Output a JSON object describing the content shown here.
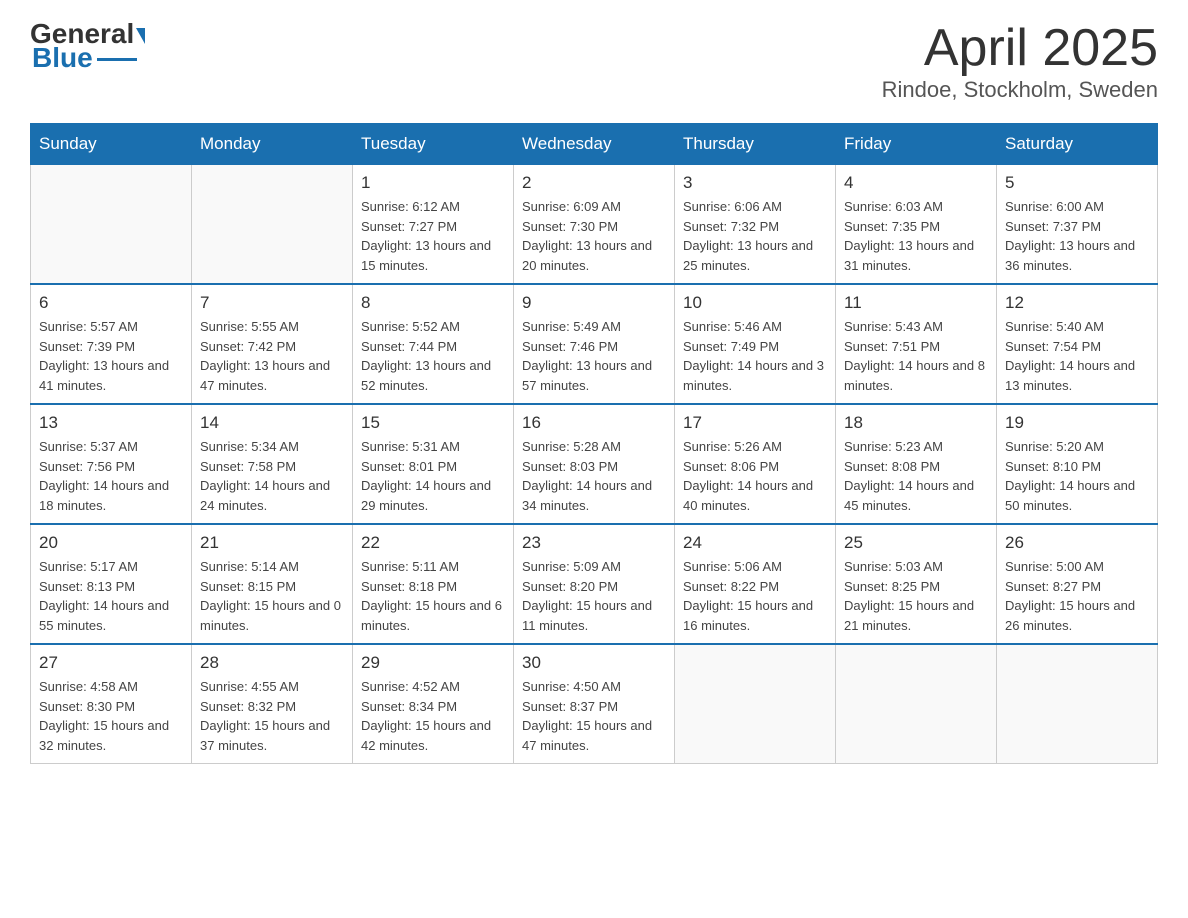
{
  "header": {
    "logo_general": "General",
    "logo_blue": "Blue",
    "month_title": "April 2025",
    "subtitle": "Rindoe, Stockholm, Sweden"
  },
  "days_of_week": [
    "Sunday",
    "Monday",
    "Tuesday",
    "Wednesday",
    "Thursday",
    "Friday",
    "Saturday"
  ],
  "weeks": [
    [
      {
        "day": "",
        "sunrise": "",
        "sunset": "",
        "daylight": "",
        "empty": true
      },
      {
        "day": "",
        "sunrise": "",
        "sunset": "",
        "daylight": "",
        "empty": true
      },
      {
        "day": "1",
        "sunrise": "Sunrise: 6:12 AM",
        "sunset": "Sunset: 7:27 PM",
        "daylight": "Daylight: 13 hours and 15 minutes."
      },
      {
        "day": "2",
        "sunrise": "Sunrise: 6:09 AM",
        "sunset": "Sunset: 7:30 PM",
        "daylight": "Daylight: 13 hours and 20 minutes."
      },
      {
        "day": "3",
        "sunrise": "Sunrise: 6:06 AM",
        "sunset": "Sunset: 7:32 PM",
        "daylight": "Daylight: 13 hours and 25 minutes."
      },
      {
        "day": "4",
        "sunrise": "Sunrise: 6:03 AM",
        "sunset": "Sunset: 7:35 PM",
        "daylight": "Daylight: 13 hours and 31 minutes."
      },
      {
        "day": "5",
        "sunrise": "Sunrise: 6:00 AM",
        "sunset": "Sunset: 7:37 PM",
        "daylight": "Daylight: 13 hours and 36 minutes."
      }
    ],
    [
      {
        "day": "6",
        "sunrise": "Sunrise: 5:57 AM",
        "sunset": "Sunset: 7:39 PM",
        "daylight": "Daylight: 13 hours and 41 minutes."
      },
      {
        "day": "7",
        "sunrise": "Sunrise: 5:55 AM",
        "sunset": "Sunset: 7:42 PM",
        "daylight": "Daylight: 13 hours and 47 minutes."
      },
      {
        "day": "8",
        "sunrise": "Sunrise: 5:52 AM",
        "sunset": "Sunset: 7:44 PM",
        "daylight": "Daylight: 13 hours and 52 minutes."
      },
      {
        "day": "9",
        "sunrise": "Sunrise: 5:49 AM",
        "sunset": "Sunset: 7:46 PM",
        "daylight": "Daylight: 13 hours and 57 minutes."
      },
      {
        "day": "10",
        "sunrise": "Sunrise: 5:46 AM",
        "sunset": "Sunset: 7:49 PM",
        "daylight": "Daylight: 14 hours and 3 minutes."
      },
      {
        "day": "11",
        "sunrise": "Sunrise: 5:43 AM",
        "sunset": "Sunset: 7:51 PM",
        "daylight": "Daylight: 14 hours and 8 minutes."
      },
      {
        "day": "12",
        "sunrise": "Sunrise: 5:40 AM",
        "sunset": "Sunset: 7:54 PM",
        "daylight": "Daylight: 14 hours and 13 minutes."
      }
    ],
    [
      {
        "day": "13",
        "sunrise": "Sunrise: 5:37 AM",
        "sunset": "Sunset: 7:56 PM",
        "daylight": "Daylight: 14 hours and 18 minutes."
      },
      {
        "day": "14",
        "sunrise": "Sunrise: 5:34 AM",
        "sunset": "Sunset: 7:58 PM",
        "daylight": "Daylight: 14 hours and 24 minutes."
      },
      {
        "day": "15",
        "sunrise": "Sunrise: 5:31 AM",
        "sunset": "Sunset: 8:01 PM",
        "daylight": "Daylight: 14 hours and 29 minutes."
      },
      {
        "day": "16",
        "sunrise": "Sunrise: 5:28 AM",
        "sunset": "Sunset: 8:03 PM",
        "daylight": "Daylight: 14 hours and 34 minutes."
      },
      {
        "day": "17",
        "sunrise": "Sunrise: 5:26 AM",
        "sunset": "Sunset: 8:06 PM",
        "daylight": "Daylight: 14 hours and 40 minutes."
      },
      {
        "day": "18",
        "sunrise": "Sunrise: 5:23 AM",
        "sunset": "Sunset: 8:08 PM",
        "daylight": "Daylight: 14 hours and 45 minutes."
      },
      {
        "day": "19",
        "sunrise": "Sunrise: 5:20 AM",
        "sunset": "Sunset: 8:10 PM",
        "daylight": "Daylight: 14 hours and 50 minutes."
      }
    ],
    [
      {
        "day": "20",
        "sunrise": "Sunrise: 5:17 AM",
        "sunset": "Sunset: 8:13 PM",
        "daylight": "Daylight: 14 hours and 55 minutes."
      },
      {
        "day": "21",
        "sunrise": "Sunrise: 5:14 AM",
        "sunset": "Sunset: 8:15 PM",
        "daylight": "Daylight: 15 hours and 0 minutes."
      },
      {
        "day": "22",
        "sunrise": "Sunrise: 5:11 AM",
        "sunset": "Sunset: 8:18 PM",
        "daylight": "Daylight: 15 hours and 6 minutes."
      },
      {
        "day": "23",
        "sunrise": "Sunrise: 5:09 AM",
        "sunset": "Sunset: 8:20 PM",
        "daylight": "Daylight: 15 hours and 11 minutes."
      },
      {
        "day": "24",
        "sunrise": "Sunrise: 5:06 AM",
        "sunset": "Sunset: 8:22 PM",
        "daylight": "Daylight: 15 hours and 16 minutes."
      },
      {
        "day": "25",
        "sunrise": "Sunrise: 5:03 AM",
        "sunset": "Sunset: 8:25 PM",
        "daylight": "Daylight: 15 hours and 21 minutes."
      },
      {
        "day": "26",
        "sunrise": "Sunrise: 5:00 AM",
        "sunset": "Sunset: 8:27 PM",
        "daylight": "Daylight: 15 hours and 26 minutes."
      }
    ],
    [
      {
        "day": "27",
        "sunrise": "Sunrise: 4:58 AM",
        "sunset": "Sunset: 8:30 PM",
        "daylight": "Daylight: 15 hours and 32 minutes."
      },
      {
        "day": "28",
        "sunrise": "Sunrise: 4:55 AM",
        "sunset": "Sunset: 8:32 PM",
        "daylight": "Daylight: 15 hours and 37 minutes."
      },
      {
        "day": "29",
        "sunrise": "Sunrise: 4:52 AM",
        "sunset": "Sunset: 8:34 PM",
        "daylight": "Daylight: 15 hours and 42 minutes."
      },
      {
        "day": "30",
        "sunrise": "Sunrise: 4:50 AM",
        "sunset": "Sunset: 8:37 PM",
        "daylight": "Daylight: 15 hours and 47 minutes."
      },
      {
        "day": "",
        "sunrise": "",
        "sunset": "",
        "daylight": "",
        "empty": true
      },
      {
        "day": "",
        "sunrise": "",
        "sunset": "",
        "daylight": "",
        "empty": true
      },
      {
        "day": "",
        "sunrise": "",
        "sunset": "",
        "daylight": "",
        "empty": true
      }
    ]
  ]
}
